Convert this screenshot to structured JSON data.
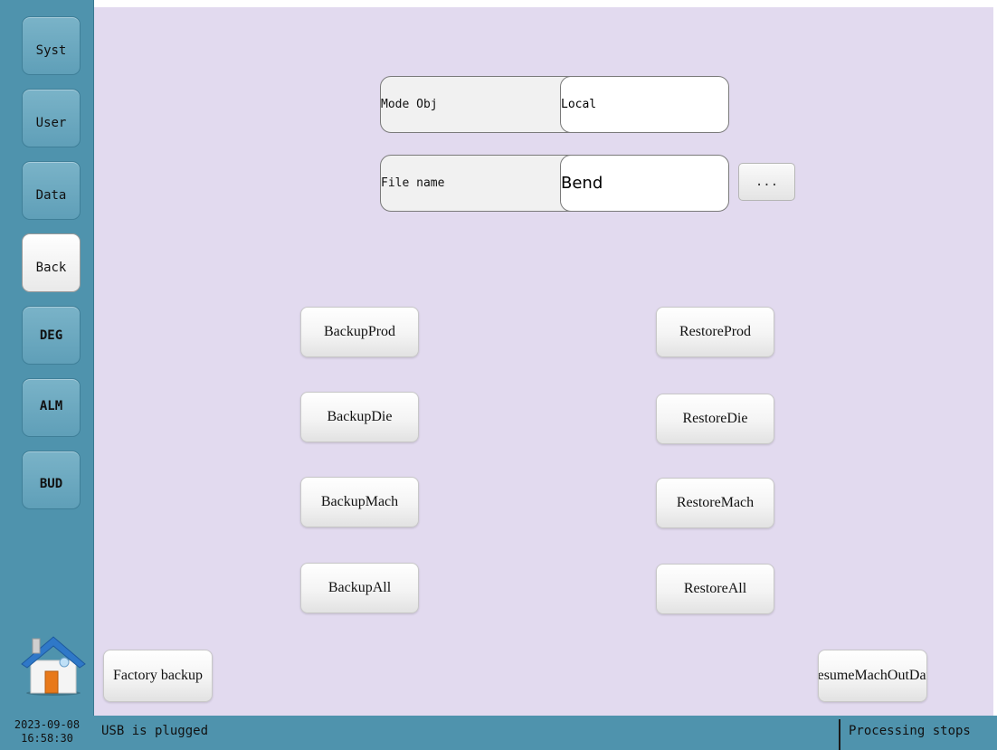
{
  "sidebar": {
    "items": [
      {
        "label": "Syst"
      },
      {
        "label": "User"
      },
      {
        "label": "Data"
      },
      {
        "label": "Back"
      },
      {
        "label": "DEG"
      },
      {
        "label": "ALM"
      },
      {
        "label": "BUD"
      }
    ],
    "active": "Back",
    "home_icon": "home-icon"
  },
  "form": {
    "mode_label": "Mode Obj",
    "mode_value": "Local",
    "file_label": "File name",
    "file_value": "Bend",
    "browse_label": "..."
  },
  "actions": {
    "backup_prod": "BackupProd",
    "backup_die": "BackupDie",
    "backup_mach": "BackupMach",
    "backup_all": "BackupAll",
    "restore_prod": "RestoreProd",
    "restore_die": "RestoreDie",
    "restore_mach": "RestoreMach",
    "restore_all": "RestoreAll",
    "factory_backup": "Factory backup",
    "resume_mach_out_dat": "esumeMachOutDat"
  },
  "status": {
    "date": "2023-09-08",
    "time": "16:58:30",
    "usb": "USB is plugged",
    "process": "Processing stops"
  },
  "colors": {
    "sidebar": "#4f93ad",
    "main_bg": "#e2daef"
  }
}
